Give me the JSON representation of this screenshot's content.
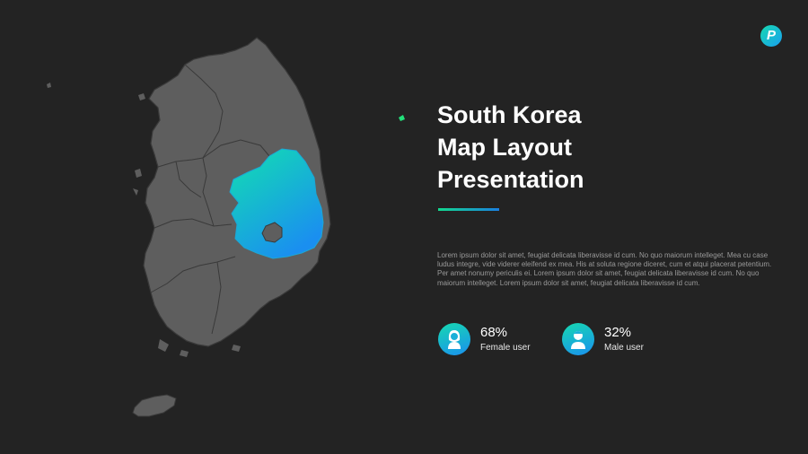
{
  "slide": {
    "title_lines": [
      "South Korea",
      "Map Layout",
      "Presentation"
    ],
    "description": "Lorem ipsum dolor sit amet, feugiat delicata liberavisse id cum. No quo maiorum intelleget. Mea cu case ludus integre, vide viderer eleifend ex mea. His at soluta regione diceret, cum et atqui placerat petentium. Per amet nonumy periculis ei. Lorem ipsum dolor sit amet, feugiat delicata liberavisse id cum. No quo maiorum intelleget. Lorem ipsum dolor sit amet, feugiat delicata liberavisse id cum.",
    "logo_letter": "P"
  },
  "stats": [
    {
      "value": "68%",
      "label": "Female user",
      "icon": "female-user-icon"
    },
    {
      "value": "32%",
      "label": "Male user",
      "icon": "male-user-icon"
    }
  ],
  "map": {
    "highlighted_region": "Gyeongsangbuk-do",
    "colors": {
      "background": "#232323",
      "region_fill": "#5e5e5e",
      "region_border": "#3a3a3a",
      "highlight_start": "#12e0b0",
      "highlight_end": "#1a8ff0",
      "island_accent": "#22e07a"
    }
  }
}
